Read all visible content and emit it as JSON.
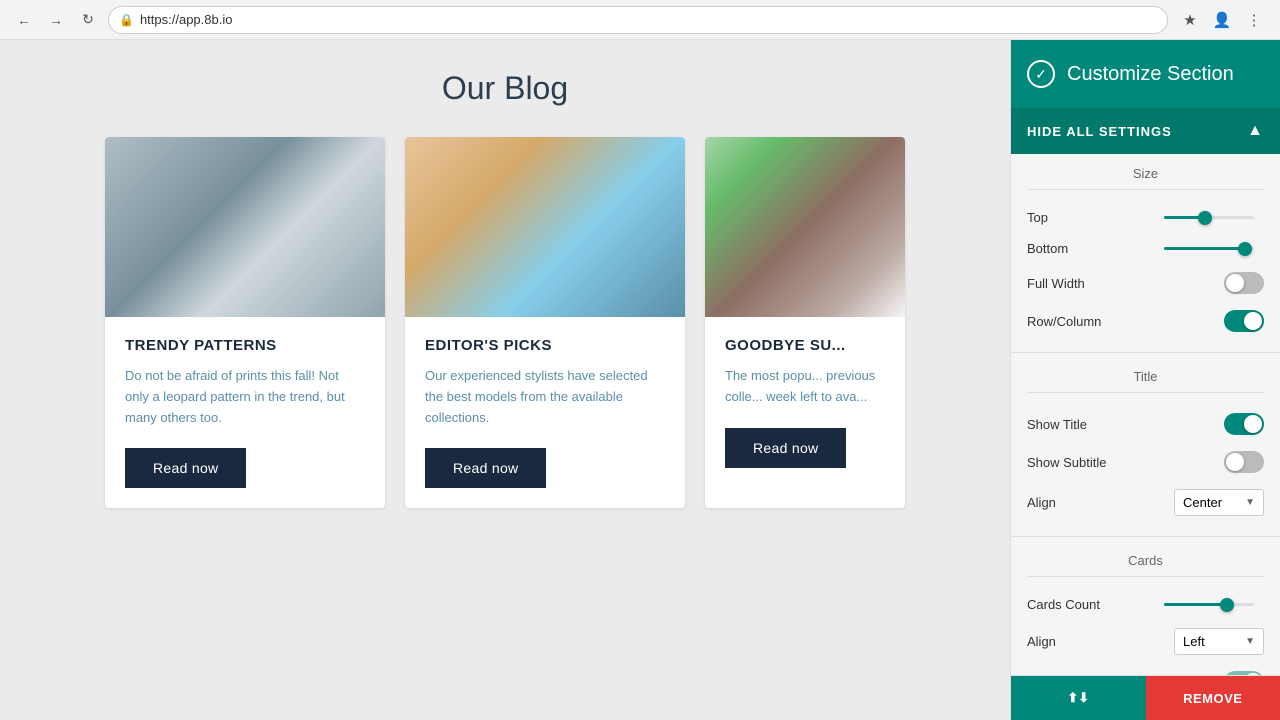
{
  "browser": {
    "url": "https://app.8b.io",
    "back_title": "Back",
    "forward_title": "Forward",
    "refresh_title": "Refresh"
  },
  "blog": {
    "title": "Our Blog",
    "cards": [
      {
        "id": "card-1",
        "title": "TRENDY PATTERNS",
        "text": "Do not be afraid of prints this fall! Not only a leopard pattern in the trend, but many others too.",
        "button": "Read now",
        "img_label": "Woman writing at desk"
      },
      {
        "id": "card-2",
        "title": "EDITOR'S PICKS",
        "text": "Our experienced stylists have selected the best models from the available collections.",
        "button": "Read now",
        "img_label": "Woman at rocky cliff by ocean"
      },
      {
        "id": "card-3",
        "title": "GOODBYE SU...",
        "text": "The most popu... previous colle... week left to ava...",
        "button": "Read now",
        "img_label": "Person with flowers outdoors"
      }
    ]
  },
  "panel": {
    "header_title": "Customize Section",
    "check_icon": "✓",
    "hide_settings_label": "HIDE ALL SETTINGS",
    "chevron": "▲",
    "sections": {
      "size_label": "Size",
      "top_label": "Top",
      "top_value": 45,
      "bottom_label": "Bottom",
      "bottom_value": 90,
      "full_width_label": "Full Width",
      "full_width_on": false,
      "row_column_label": "Row/Column",
      "row_column_on": true,
      "title_section_label": "Title",
      "show_title_label": "Show Title",
      "show_title_on": true,
      "show_subtitle_label": "Show Subtitle",
      "show_subtitle_on": false,
      "align_title_label": "Align",
      "align_title_value": "Center",
      "cards_section_label": "Cards",
      "cards_count_label": "Cards Count",
      "cards_count_value": 70,
      "align_cards_label": "Align",
      "align_cards_value": "Left"
    },
    "footer": {
      "move_icon": "⬆⬇",
      "remove_label": "REMOVE"
    }
  }
}
